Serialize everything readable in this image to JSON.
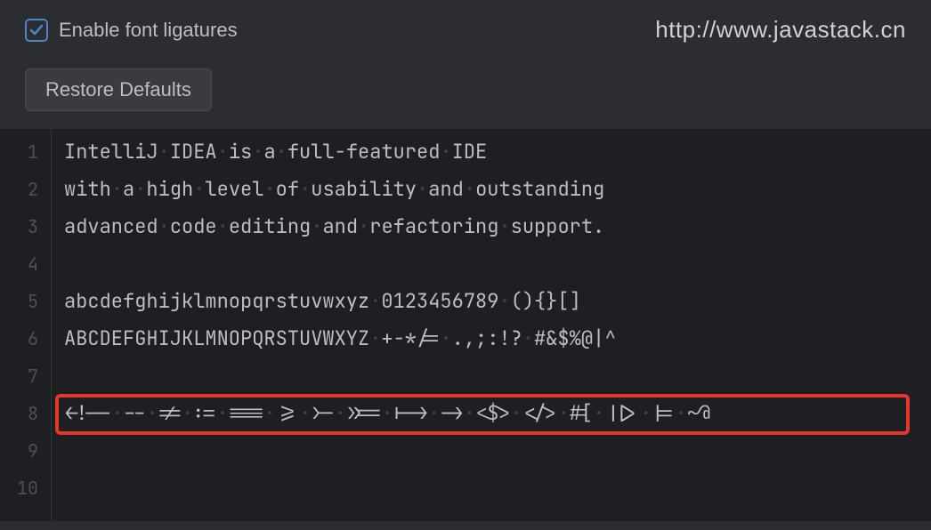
{
  "header": {
    "checkbox_checked": true,
    "checkbox_label": "Enable font ligatures",
    "url": "http://www.javastack.cn",
    "restore_button": "Restore Defaults"
  },
  "editor": {
    "line_numbers": [
      "1",
      "2",
      "3",
      "4",
      "5",
      "6",
      "7",
      "8",
      "9",
      "10"
    ],
    "lines": [
      "IntelliJ IDEA is a full-featured IDE",
      "with a high level of usability and outstanding",
      "advanced code editing and refactoring support.",
      "",
      "abcdefghijklmnopqrstuvwxyz 0123456789 (){}[]",
      "ABCDEFGHIJKLMNOPQRSTUVWXYZ +-*/= .,;:!? #&$%@|^",
      "",
      "<!-- -- != := === >= >- >>= |-> -> <$> </> #[ ||> |= ~@",
      "",
      ""
    ],
    "highlight_line_index": 7
  }
}
